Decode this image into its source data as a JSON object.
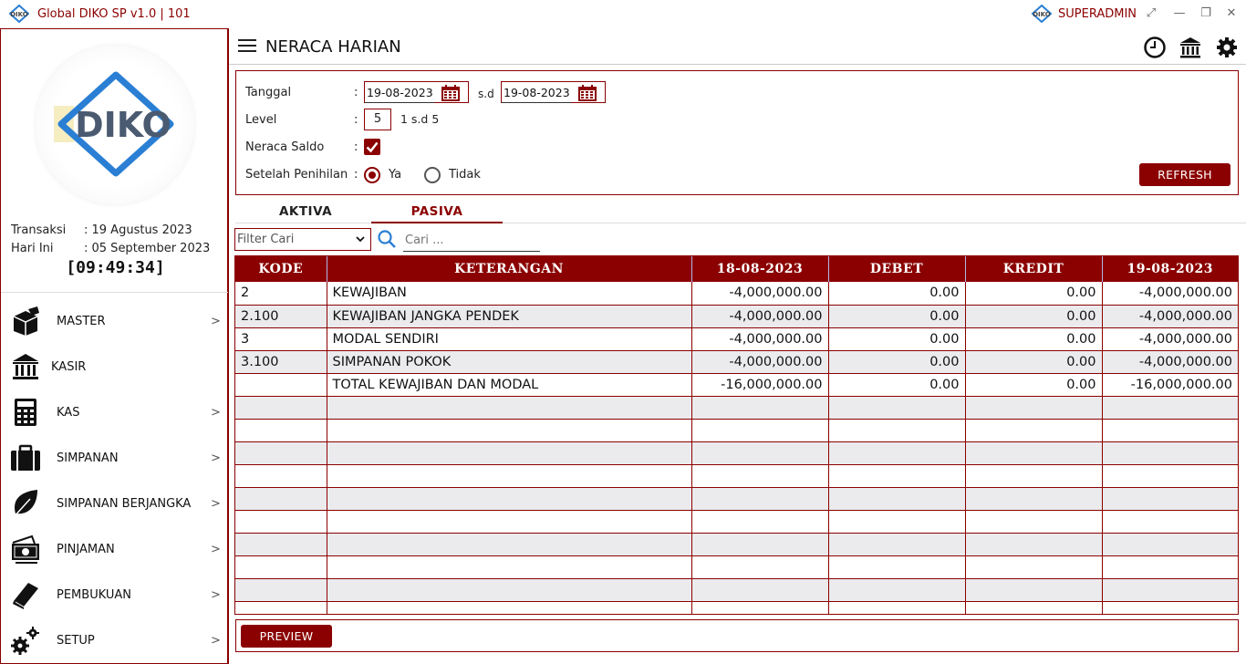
{
  "window": {
    "title": "Global DIKO SP v1.0 | 101",
    "user": "SUPERADMIN"
  },
  "sidebar": {
    "logo_text": "DIKO",
    "transaksi_label": "Transaksi",
    "transaksi_value": ": 19 Agustus 2023",
    "hari_ini_label": "Hari Ini",
    "hari_ini_value": ": 05 September 2023",
    "clock": "[09:49:34]",
    "menu": [
      {
        "label": "MASTER",
        "icon": "cube-icon",
        "chevron": ">"
      },
      {
        "label": "KASIR",
        "icon": "bank-icon",
        "chevron": ""
      },
      {
        "label": "KAS",
        "icon": "calculator-icon",
        "chevron": ">"
      },
      {
        "label": "SIMPANAN",
        "icon": "briefcase-icon",
        "chevron": ">"
      },
      {
        "label": "SIMPANAN BERJANGKA",
        "icon": "leaf-icon",
        "chevron": ">"
      },
      {
        "label": "PINJAMAN",
        "icon": "money-icon",
        "chevron": ">"
      },
      {
        "label": "PEMBUKUAN",
        "icon": "book-icon",
        "chevron": ">"
      },
      {
        "label": "SETUP",
        "icon": "gears-icon",
        "chevron": ">"
      }
    ]
  },
  "header": {
    "title": "NERACA HARIAN"
  },
  "filters": {
    "tanggal_label": "Tanggal",
    "date_from": "19-08-2023",
    "sd_label": "s.d",
    "date_to": "19-08-2023",
    "level_label": "Level",
    "level_value": "5",
    "level_range": "1 s.d 5",
    "neraca_saldo_label": "Neraca Saldo",
    "neraca_saldo_checked": true,
    "setelah_label": "Setelah Penihilan",
    "opt_ya": "Ya",
    "opt_tidak": "Tidak",
    "selected": "Ya",
    "colon": ":",
    "refresh_label": "REFRESH"
  },
  "tabs": [
    {
      "label": "AKTIVA",
      "active": false
    },
    {
      "label": "PASIVA",
      "active": true
    }
  ],
  "search": {
    "filter_placeholder": "Filter Cari",
    "placeholder": "Cari ..."
  },
  "table": {
    "columns": [
      "KODE",
      "KETERANGAN",
      "18-08-2023",
      "DEBET",
      "KREDIT",
      "19-08-2023"
    ],
    "rows": [
      [
        "2",
        "KEWAJIBAN",
        "-4,000,000.00",
        "0.00",
        "0.00",
        "-4,000,000.00"
      ],
      [
        "2.100",
        "KEWAJIBAN JANGKA PENDEK",
        "-4,000,000.00",
        "0.00",
        "0.00",
        "-4,000,000.00"
      ],
      [
        "3",
        "MODAL SENDIRI",
        "-4,000,000.00",
        "0.00",
        "0.00",
        "-4,000,000.00"
      ],
      [
        "3.100",
        "SIMPANAN POKOK",
        "-4,000,000.00",
        "0.00",
        "0.00",
        "-4,000,000.00"
      ],
      [
        "",
        "TOTAL KEWAJIBAN DAN MODAL",
        "-16,000,000.00",
        "0.00",
        "0.00",
        "-16,000,000.00"
      ],
      [
        "",
        "",
        "",
        "",
        "",
        ""
      ],
      [
        "",
        "",
        "",
        "",
        "",
        ""
      ],
      [
        "",
        "",
        "",
        "",
        "",
        ""
      ],
      [
        "",
        "",
        "",
        "",
        "",
        ""
      ],
      [
        "",
        "",
        "",
        "",
        "",
        ""
      ],
      [
        "",
        "",
        "",
        "",
        "",
        ""
      ],
      [
        "",
        "",
        "",
        "",
        "",
        ""
      ],
      [
        "",
        "",
        "",
        "",
        "",
        ""
      ],
      [
        "",
        "",
        "",
        "",
        "",
        ""
      ],
      [
        "",
        "",
        "",
        "",
        "",
        ""
      ]
    ]
  },
  "footer": {
    "preview_label": "PREVIEW"
  },
  "colors": {
    "accent": "#8b0000",
    "logo_blue": "#2a7fd4"
  }
}
